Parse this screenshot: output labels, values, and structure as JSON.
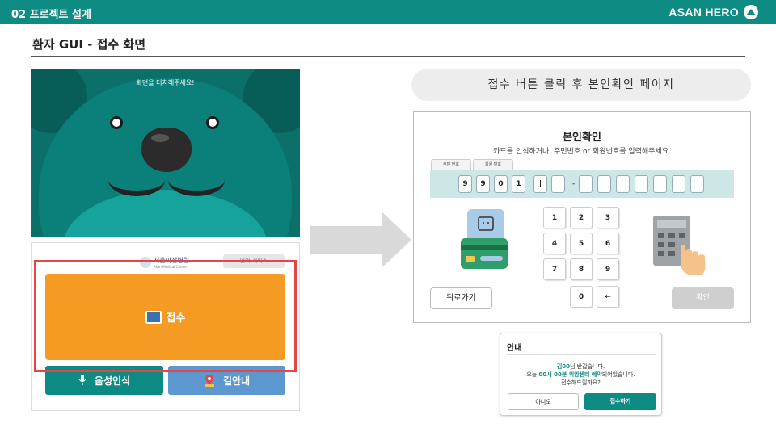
{
  "header": {
    "section": "02 프로젝트 설계",
    "brand": "ASAN HERO"
  },
  "page_title": "환자 GUI - 접수 화면",
  "idle_screen": {
    "message": "화면을 터치해주세요!"
  },
  "home_screen": {
    "hospital_name": "서울아산병원",
    "hospital_sub": "Asan Medical Center",
    "language_button": "언어 서비스",
    "reception_label": "접수",
    "voice_label": "음성인식",
    "wayfinding_label": "길안내"
  },
  "caption": "접수 버튼 클릭 후 본인확인 페이지",
  "verify": {
    "title": "본인확인",
    "subtitle": "카드를 인식하거나, 주민번호 or 회원번호를 입력해주세요.",
    "tabs": [
      "주민 번호",
      "회원 번호"
    ],
    "digits": [
      "9",
      "9",
      "0",
      "1",
      "|",
      "",
      "",
      "",
      "",
      "",
      "",
      "",
      ""
    ],
    "keypad": [
      "1",
      "2",
      "3",
      "4",
      "5",
      "6",
      "7",
      "8",
      "9",
      "0",
      "←"
    ],
    "back_label": "뒤로가기",
    "confirm_label": "확인"
  },
  "dialog": {
    "title": "안내",
    "name": "김00",
    "greeting_suffix": "님 반갑습니다.",
    "line2_prefix": "오늘 ",
    "appointment": "00시 00분 위암센터 예약",
    "line2_suffix": "되어있습니다.",
    "line3": "접수해드릴까요?",
    "no_label": "아니오",
    "yes_label": "접수하기"
  },
  "colors": {
    "teal": "#0e8c84",
    "orange": "#f59a23",
    "blue": "#5d97d0",
    "highlight": "#e44545"
  }
}
